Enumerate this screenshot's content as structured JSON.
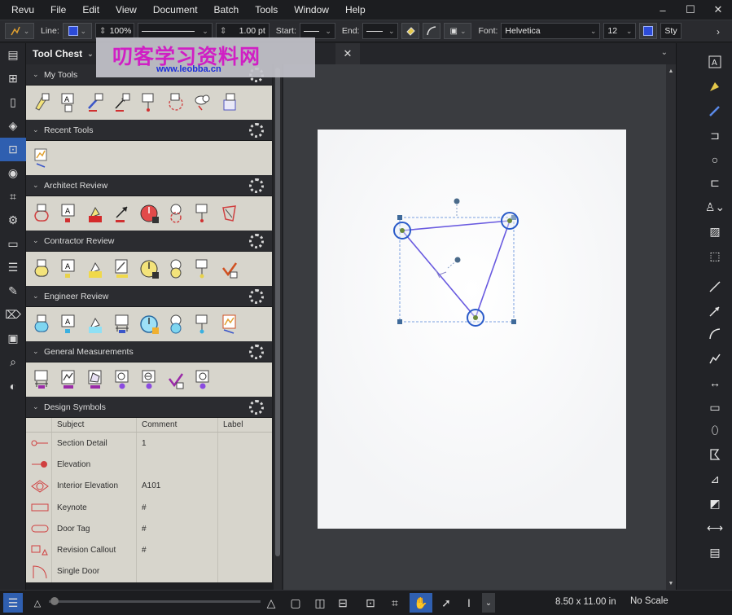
{
  "menu": [
    "Revu",
    "File",
    "Edit",
    "View",
    "Document",
    "Batch",
    "Tools",
    "Window",
    "Help"
  ],
  "window_controls": {
    "minimize": "–",
    "maximize": "☐",
    "close": "✕"
  },
  "propbar": {
    "line_label": "Line:",
    "opacity": "100%",
    "width": "1.00 pt",
    "start_label": "Start:",
    "end_label": "End:",
    "font_label": "Font:",
    "font_value": "Helvetica",
    "font_size": "12",
    "style_label": "Sty",
    "line_color": "#2c4bd8"
  },
  "panel": {
    "title": "Tool Chest",
    "sections": [
      {
        "title": "My Tools"
      },
      {
        "title": "Recent Tools"
      },
      {
        "title": "Architect Review"
      },
      {
        "title": "Contractor Review"
      },
      {
        "title": "Engineer Review"
      },
      {
        "title": "General Measurements"
      },
      {
        "title": "Design Symbols"
      }
    ],
    "table_headers": {
      "subject": "Subject",
      "comment": "Comment",
      "label": "Label"
    },
    "symbols": [
      {
        "subject": "Section Detail",
        "comment": "1",
        "label": ""
      },
      {
        "subject": "Elevation",
        "comment": "",
        "label": ""
      },
      {
        "subject": "Interior Elevation",
        "comment": "A101",
        "label": ""
      },
      {
        "subject": "Keynote",
        "comment": "#",
        "label": ""
      },
      {
        "subject": "Door Tag",
        "comment": "#",
        "label": ""
      },
      {
        "subject": "Revision Callout",
        "comment": "#",
        "label": ""
      },
      {
        "subject": "Single Door",
        "comment": "",
        "label": ""
      }
    ]
  },
  "document": {
    "tab_close": "✕"
  },
  "status": {
    "page_size": "8.50 x 11.00 in",
    "scale": "No Scale"
  },
  "watermark": {
    "title": "叨客学习资料网",
    "url": "www.leobba.cn"
  },
  "colors": {
    "accent": "#2f5fb0",
    "markup": "#6a5be0",
    "panel_bg": "#d7d5cc"
  }
}
